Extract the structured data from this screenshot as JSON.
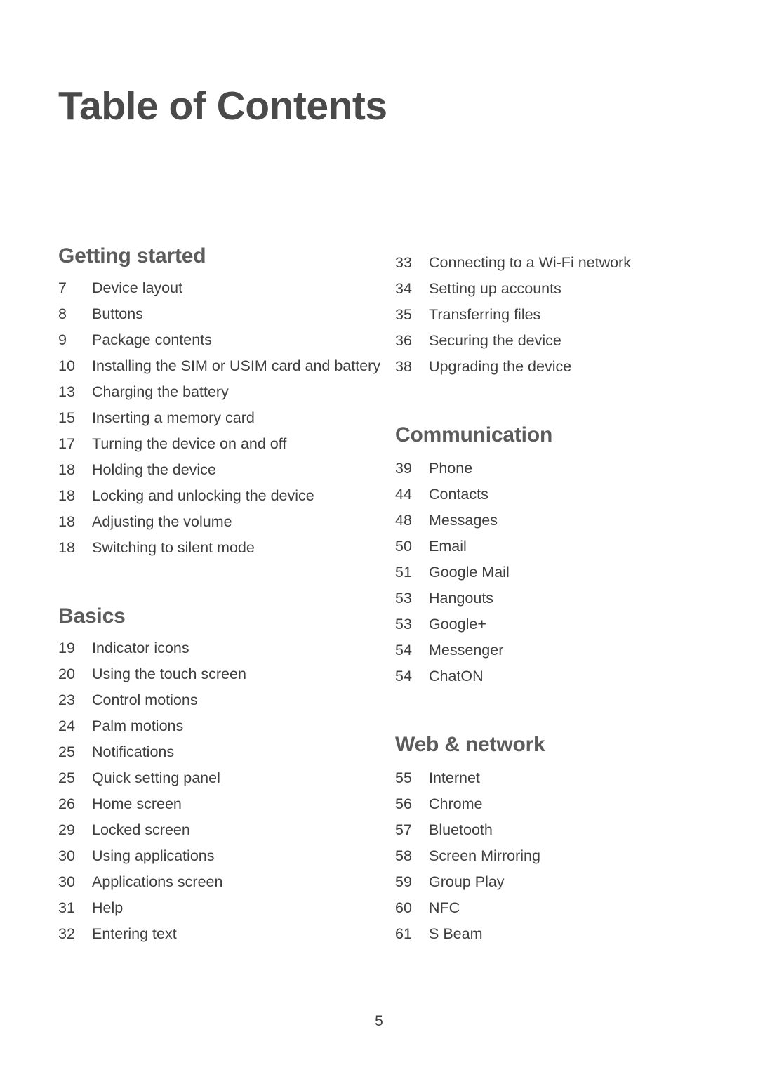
{
  "document": {
    "title": "Table of Contents",
    "page_number": "5"
  },
  "left_column": [
    {
      "heading": "Getting started",
      "entries": [
        {
          "page": "7",
          "label": "Device layout"
        },
        {
          "page": "8",
          "label": "Buttons"
        },
        {
          "page": "9",
          "label": "Package contents"
        },
        {
          "page": "10",
          "label": "Installing the SIM or USIM card and battery"
        },
        {
          "page": "13",
          "label": "Charging the battery"
        },
        {
          "page": "15",
          "label": "Inserting a memory card"
        },
        {
          "page": "17",
          "label": "Turning the device on and off"
        },
        {
          "page": "18",
          "label": "Holding the device"
        },
        {
          "page": "18",
          "label": "Locking and unlocking the device"
        },
        {
          "page": "18",
          "label": "Adjusting the volume"
        },
        {
          "page": "18",
          "label": "Switching to silent mode"
        }
      ]
    },
    {
      "heading": "Basics",
      "entries": [
        {
          "page": "19",
          "label": "Indicator icons"
        },
        {
          "page": "20",
          "label": "Using the touch screen"
        },
        {
          "page": "23",
          "label": "Control motions"
        },
        {
          "page": "24",
          "label": "Palm motions"
        },
        {
          "page": "25",
          "label": "Notifications"
        },
        {
          "page": "25",
          "label": "Quick setting panel"
        },
        {
          "page": "26",
          "label": "Home screen"
        },
        {
          "page": "29",
          "label": "Locked screen"
        },
        {
          "page": "30",
          "label": "Using applications"
        },
        {
          "page": "30",
          "label": "Applications screen"
        },
        {
          "page": "31",
          "label": "Help"
        },
        {
          "page": "32",
          "label": "Entering text"
        }
      ]
    }
  ],
  "right_column": {
    "continued_entries": [
      {
        "page": "33",
        "label": "Connecting to a Wi-Fi network"
      },
      {
        "page": "34",
        "label": "Setting up accounts"
      },
      {
        "page": "35",
        "label": "Transferring files"
      },
      {
        "page": "36",
        "label": "Securing the device"
      },
      {
        "page": "38",
        "label": "Upgrading the device"
      }
    ],
    "sections": [
      {
        "heading": "Communication",
        "entries": [
          {
            "page": "39",
            "label": "Phone"
          },
          {
            "page": "44",
            "label": "Contacts"
          },
          {
            "page": "48",
            "label": "Messages"
          },
          {
            "page": "50",
            "label": "Email"
          },
          {
            "page": "51",
            "label": "Google Mail"
          },
          {
            "page": "53",
            "label": "Hangouts"
          },
          {
            "page": "53",
            "label": "Google+"
          },
          {
            "page": "54",
            "label": "Messenger"
          },
          {
            "page": "54",
            "label": "ChatON"
          }
        ]
      },
      {
        "heading": "Web & network",
        "entries": [
          {
            "page": "55",
            "label": "Internet"
          },
          {
            "page": "56",
            "label": "Chrome"
          },
          {
            "page": "57",
            "label": "Bluetooth"
          },
          {
            "page": "58",
            "label": "Screen Mirroring"
          },
          {
            "page": "59",
            "label": "Group Play"
          },
          {
            "page": "60",
            "label": "NFC"
          },
          {
            "page": "61",
            "label": "S Beam"
          }
        ]
      }
    ]
  }
}
